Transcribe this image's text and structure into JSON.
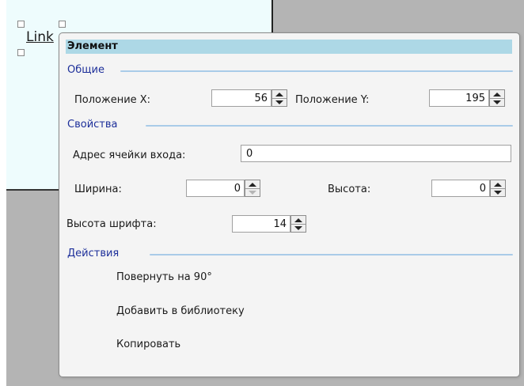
{
  "canvas": {
    "link_label": "Link"
  },
  "panel": {
    "title": "Элемент",
    "sections": {
      "general": "Общие",
      "properties": "Свойства",
      "actions": "Действия"
    },
    "fields": {
      "pos_x_label": "Положение X:",
      "pos_x_value": "56",
      "pos_y_label": "Положение Y:",
      "pos_y_value": "195",
      "input_address_label": "Адрес ячейки входа:",
      "input_address_value": "0",
      "width_label": "Ширина:",
      "width_value": "0",
      "height_label": "Высота:",
      "height_value": "0",
      "font_height_label": "Высота шрифта:",
      "font_height_value": "14"
    },
    "actions": {
      "rotate": "Повернуть на 90°",
      "add_to_library": "Добавить в библиотеку",
      "copy": "Копировать"
    }
  },
  "icons": {
    "spin_up": "triangle-up-icon",
    "spin_down": "triangle-down-icon"
  },
  "colors": {
    "title_bar": "#add8e6",
    "section_heading": "#1d2f9a",
    "section_rule": "#a9cbe8",
    "canvas_area": "#eefcfd",
    "canvas_outside": "#b4b4b4"
  }
}
